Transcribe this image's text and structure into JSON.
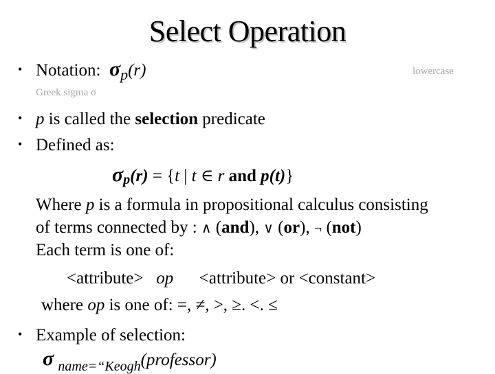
{
  "slide": {
    "title": "Select Operation",
    "notation": {
      "label": "Notation:",
      "sigma": "σ",
      "sub": "p",
      "arg": "(r)",
      "note_greek": "Greek sigma σ",
      "note_lowercase": "lowercase"
    },
    "bullet_char": "•",
    "predicate": {
      "p": "p",
      "pre": " is called the ",
      "bold": "selection",
      "post": " predicate"
    },
    "defined_as": "Defined as:",
    "definition": {
      "sigma": "σ",
      "sub": "p",
      "arg": "(r)",
      "eq": " = {",
      "t1": "t",
      "bar": " | ",
      "t2": "t",
      "in": " ∈ ",
      "r": "r",
      "and": " and ",
      "pt": "p(t)",
      "close": "}"
    },
    "where": {
      "line1_a": "Where ",
      "line1_p": "p",
      "line1_b": " is a formula in propositional calculus consisting",
      "line2_a": "of terms connected by : ",
      "and_sym": "∧",
      "and_lbl": "and",
      "or_sym": "∨",
      "or_lbl": "or",
      "not_sym": "¬",
      "not_lbl": "not",
      "line3": "Each term is one of:",
      "term_a": "<attribute>",
      "term_op": "op",
      "term_b": "<attribute> or <constant>",
      "ops_a": "where ",
      "ops_op": "op",
      "ops_b": " is one of:  =, ≠, >, ≥. <. ≤"
    },
    "example": {
      "label": "Example of selection:",
      "sigma": "σ",
      "sub": "name=“Keogh",
      "arg": "(professor)"
    }
  }
}
